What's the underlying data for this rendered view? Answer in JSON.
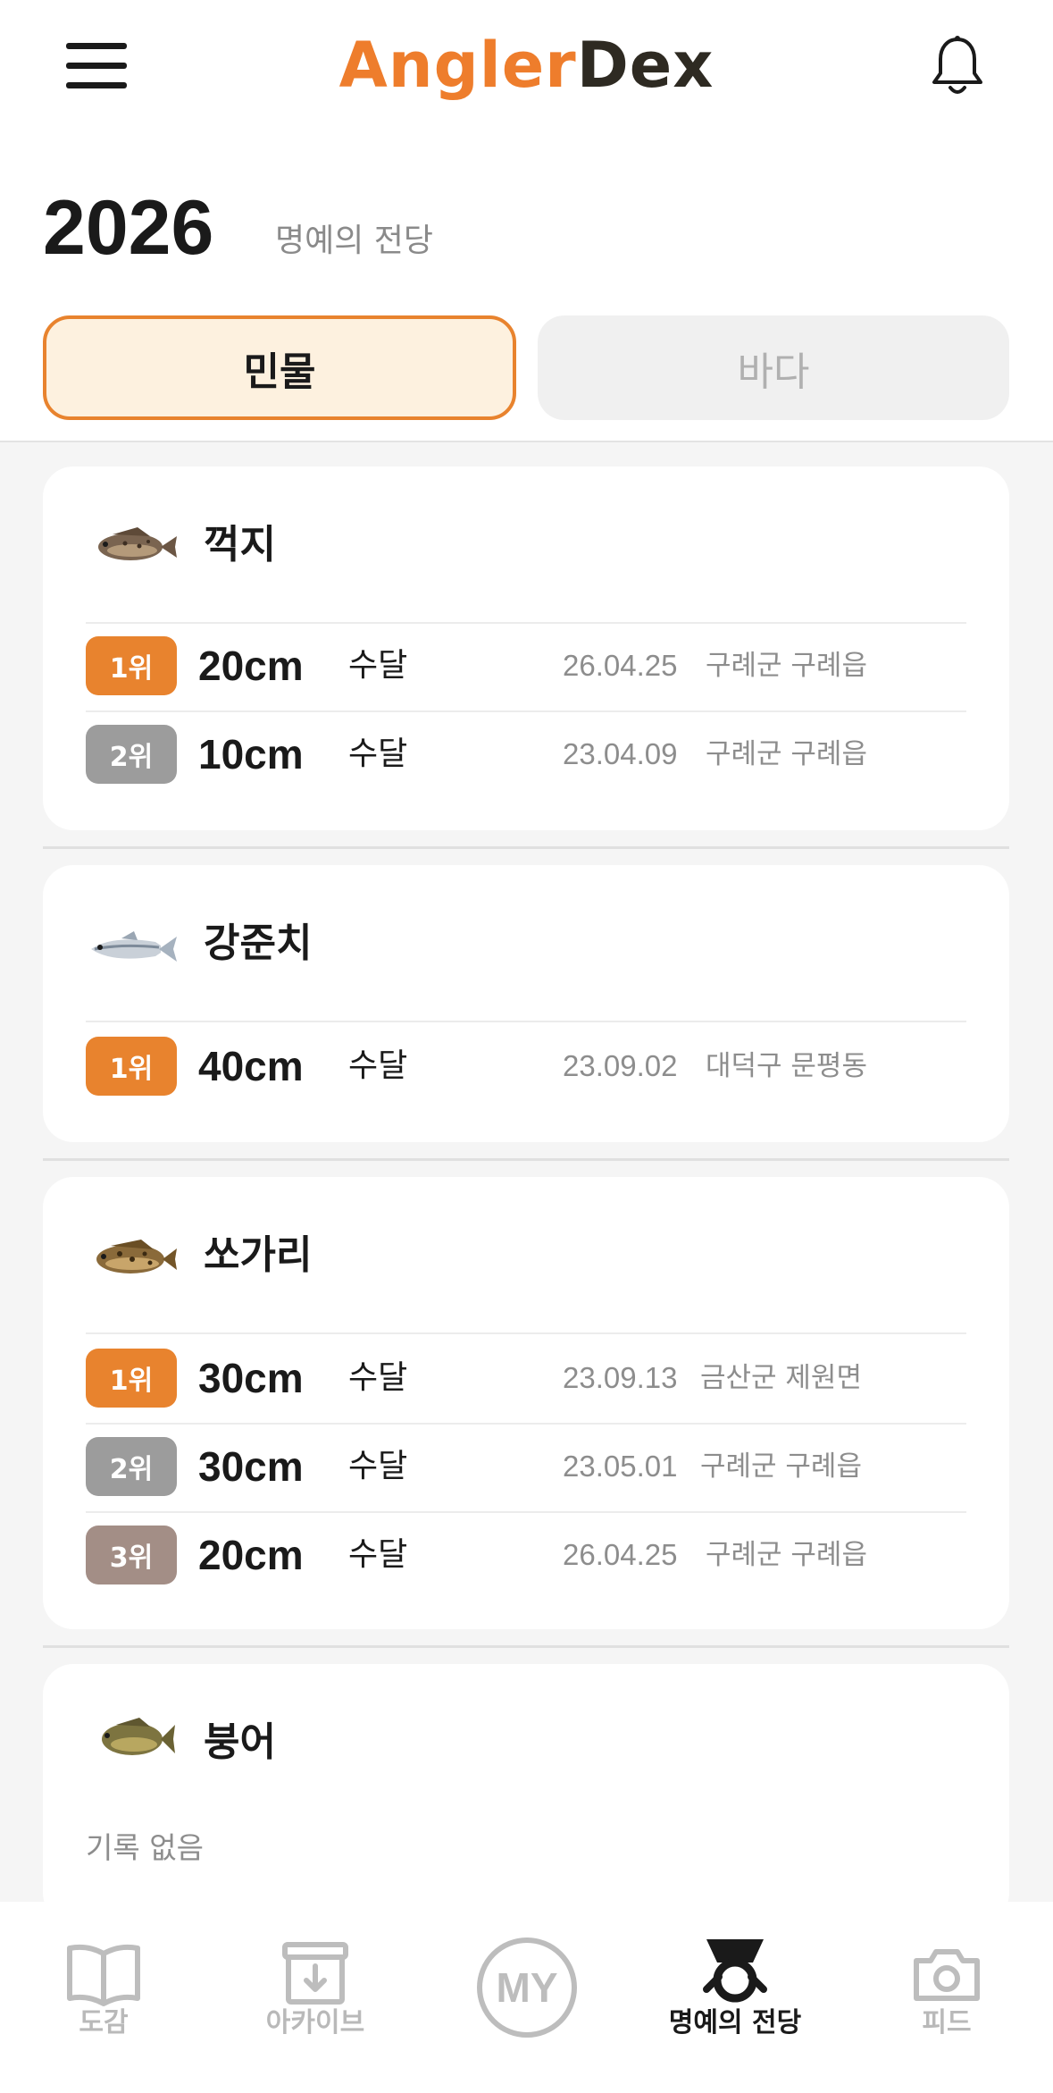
{
  "header": {
    "logo_part1": "Angler",
    "logo_part2": "Dex",
    "menu_icon": "hamburger-menu-icon",
    "bell_icon": "bell-icon"
  },
  "hall": {
    "year": "2026",
    "subtitle": "명예의 전당"
  },
  "tabs": [
    {
      "label": "민물",
      "active": true
    },
    {
      "label": "바다",
      "active": false
    }
  ],
  "cards": [
    {
      "name": "꺽지",
      "records": [
        {
          "rank": "1위",
          "size": "20cm",
          "method": "수달",
          "date": "26.04.25",
          "place": "구례군 구례읍"
        },
        {
          "rank": "2위",
          "size": "10cm",
          "method": "수달",
          "date": "23.04.09",
          "place": "구례군 구례읍"
        }
      ]
    },
    {
      "name": "강준치",
      "records": [
        {
          "rank": "1위",
          "size": "40cm",
          "method": "수달",
          "date": "23.09.02",
          "place": "대덕구 문평동"
        }
      ]
    },
    {
      "name": "쏘가리",
      "records": [
        {
          "rank": "1위",
          "size": "30cm",
          "method": "수달",
          "date": "23.09.13",
          "place": "금산군 제원면"
        },
        {
          "rank": "2위",
          "size": "30cm",
          "method": "수달",
          "date": "23.05.01",
          "place": "구례군 구례읍"
        },
        {
          "rank": "3위",
          "size": "20cm",
          "method": "수달",
          "date": "26.04.25",
          "place": "구례군 구례읍"
        }
      ]
    },
    {
      "name": "붕어",
      "empty_text": "기록 없음"
    }
  ],
  "nav": [
    {
      "label": "도감",
      "icon": "book-icon",
      "active": false
    },
    {
      "label": "아카이브",
      "icon": "archive-icon",
      "active": false
    },
    {
      "label": "MY",
      "icon": "my-circle-icon",
      "active": false
    },
    {
      "label": "명예의 전당",
      "icon": "trophy-medal-icon",
      "active": true
    },
    {
      "label": "피드",
      "icon": "camera-icon",
      "active": false
    }
  ],
  "colors": {
    "accent": "#e8832e",
    "rank2": "#9c9c9c",
    "rank3": "#a38e86",
    "tab_active_bg": "#fdf1df"
  }
}
